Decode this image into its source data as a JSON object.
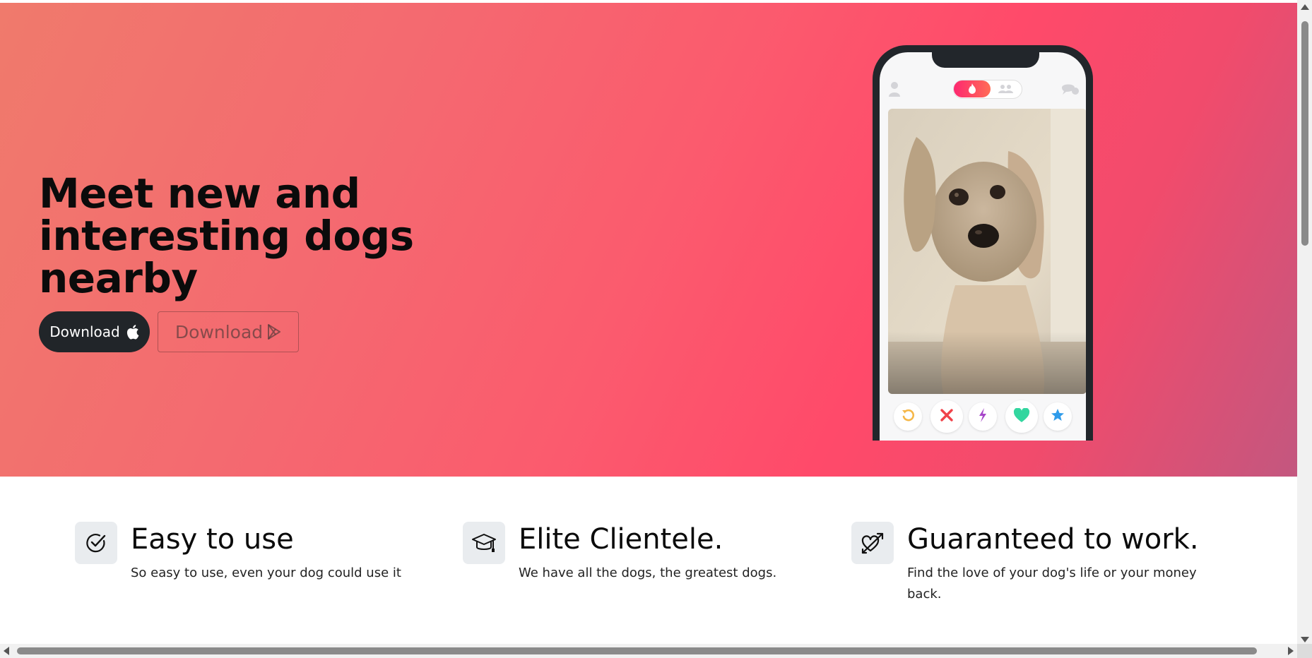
{
  "hero": {
    "headline": "Meet new and interesting dogs nearby",
    "ios_button_label": "Download",
    "play_button_label": "Download",
    "gradient_colors": [
      "#f07a6c",
      "#ff4a6a",
      "#c3577f"
    ]
  },
  "phone": {
    "action_buttons": [
      {
        "name": "rewind-icon",
        "color": "#f5b748"
      },
      {
        "name": "nope-icon",
        "color": "#f0424a"
      },
      {
        "name": "boost-icon",
        "color": "#a646c9"
      },
      {
        "name": "like-icon",
        "color": "#33d69f"
      },
      {
        "name": "super-like-icon",
        "color": "#2f9bea"
      }
    ]
  },
  "features": [
    {
      "title": "Easy to use",
      "description": "So easy to use, even your dog could use it",
      "icon": "check-circle-icon"
    },
    {
      "title": "Elite Clientele.",
      "description": "We have all the dogs, the greatest dogs.",
      "icon": "mortarboard-icon"
    },
    {
      "title": "Guaranteed to work.",
      "description": "Find the love of your dog's life or your money back.",
      "icon": "heart-arrow-icon"
    }
  ]
}
